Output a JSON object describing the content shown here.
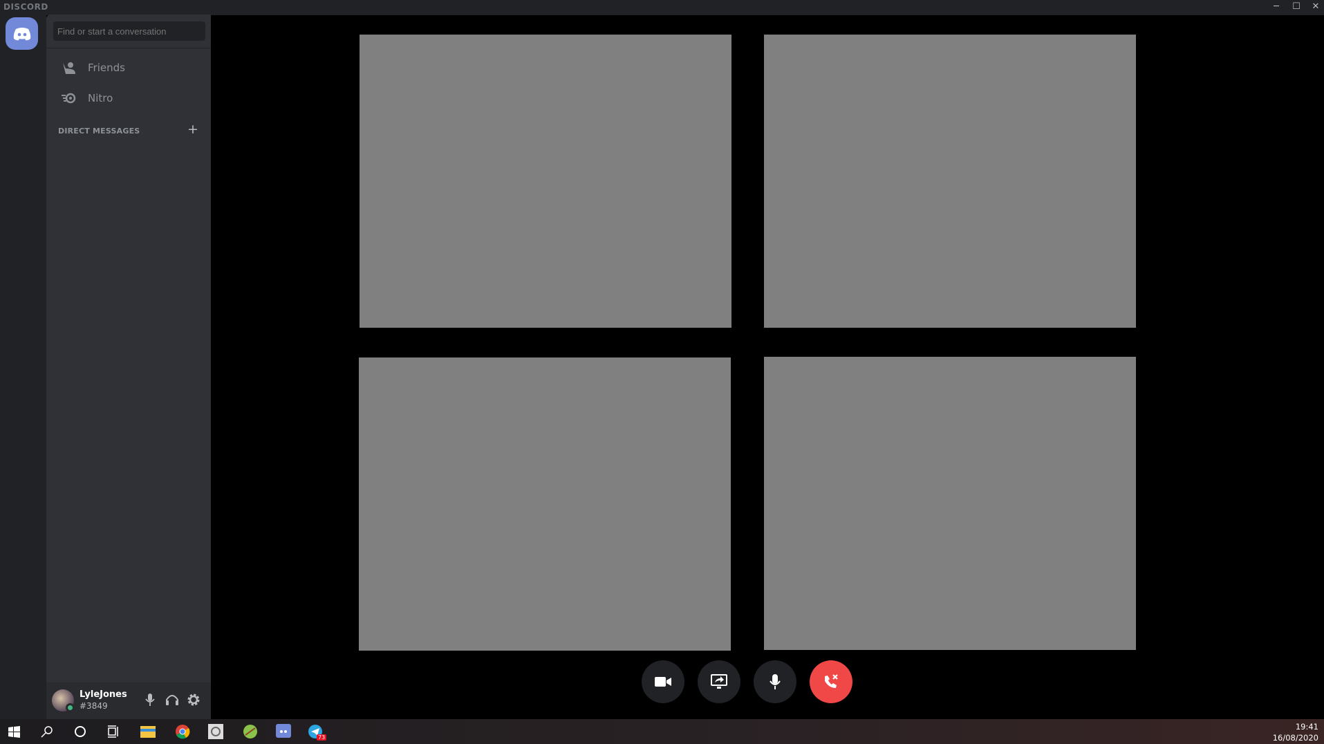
{
  "window": {
    "brand": "DISCORD",
    "minimize": "─",
    "maximize": "☐",
    "close": "✕"
  },
  "sidebar": {
    "search_placeholder": "Find or start a conversation",
    "nav": [
      {
        "label": "Friends",
        "icon": "friends-icon"
      },
      {
        "label": "Nitro",
        "icon": "nitro-icon"
      }
    ],
    "dm_header": "DIRECT MESSAGES",
    "dm_add": "+"
  },
  "user": {
    "name": "LyleJones",
    "tag": "#3849",
    "status_color": "#43b581"
  },
  "call": {
    "tiles": 4,
    "controls": [
      "camera",
      "screen-share",
      "microphone",
      "disconnect"
    ],
    "disconnect_color": "#f04747"
  },
  "taskbar": {
    "time": "19:41",
    "date": "16/08/2020",
    "telegram_badge": "73"
  },
  "colors": {
    "accent": "#7289da"
  }
}
